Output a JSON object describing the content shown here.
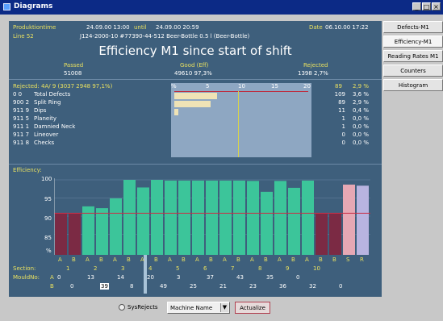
{
  "window": {
    "title": "Diagrams"
  },
  "header": {
    "prod_label": "Produktiontime",
    "from": "24.09.00 13:00",
    "until_label": "until",
    "until": "24.09.00 20:59",
    "date_label": "Date",
    "date": "06.10.00 17:22",
    "line": "Line 52",
    "product": "J124-2000-10 #77390-44-512 Beer-Bottle 0.5 l (Beer-Bottle)"
  },
  "main_title": "Efficiency M1 since start of shift",
  "summary": [
    {
      "label": "Passed",
      "value": "51008"
    },
    {
      "label": "Good (Eff)",
      "value": "49610  97,3%"
    },
    {
      "label": "Rejected",
      "value": "1398  2,7%"
    }
  ],
  "rejects": {
    "header": "Rejected: 4A/ 9   (3037   2948 97,1%)",
    "axis_ticks": [
      "%",
      "5",
      "10",
      "15",
      "20"
    ],
    "header_count": "89",
    "header_pct": "2,9 %",
    "rows": [
      {
        "code": "0  0",
        "name": "Total Defects",
        "count": "109",
        "pct": "3,6 %",
        "bar": 6.5
      },
      {
        "code": "900  2",
        "name": "Split Ring",
        "count": "89",
        "pct": "2,9 %",
        "bar": 5.6
      },
      {
        "code": "911  9",
        "name": "Dips",
        "count": "11",
        "pct": "0,4 %",
        "bar": 0.6
      },
      {
        "code": "911  5",
        "name": "Planeity",
        "count": "1",
        "pct": "0,0 %",
        "bar": 0
      },
      {
        "code": "911  1",
        "name": "Damnied Neck",
        "count": "1",
        "pct": "0,0 %",
        "bar": 0
      },
      {
        "code": "911  7",
        "name": "Lineover",
        "count": "0",
        "pct": "0,0 %",
        "bar": 0
      },
      {
        "code": "911  8",
        "name": "Checks",
        "count": "0",
        "pct": "0,0 %",
        "bar": 0
      }
    ]
  },
  "efficiency": {
    "label": "Efficiency:",
    "yticks": [
      "100",
      "95",
      "90",
      "85",
      "%"
    ],
    "section_label": "Section:",
    "mould_label": "MouldNo:",
    "mould_row_a": "A",
    "mould_row_b": "B",
    "bar_labels": [
      "A",
      "B",
      "A",
      "B",
      "A",
      "B",
      "A",
      "B",
      "A",
      "B",
      "A",
      "B",
      "A",
      "B",
      "A",
      "B",
      "A",
      "B",
      "A",
      "B",
      "B",
      "S",
      "R"
    ],
    "section_numbers": [
      "1",
      "2",
      "3",
      "4",
      "5",
      "6",
      "7",
      "8",
      "9",
      "10"
    ],
    "mould_a": [
      "0",
      "13",
      "14",
      "20",
      "3",
      "37",
      "43",
      "35",
      "0"
    ],
    "mould_b": [
      "0",
      "39",
      "8",
      "49",
      "25",
      "21",
      "23",
      "36",
      "32",
      "0"
    ],
    "mould_b_highlight": "39"
  },
  "chart_data": {
    "type": "bar",
    "title": "Efficiency M1 since start of shift",
    "categories": [
      "1A",
      "1B",
      "2A",
      "2B",
      "3A",
      "3B",
      "4A",
      "4B",
      "5A",
      "5B",
      "6A",
      "6B",
      "7A",
      "7B",
      "8A",
      "8B",
      "9A",
      "9B",
      "10A",
      "10B",
      "B",
      "S",
      "R"
    ],
    "values": [
      90.8,
      90.8,
      92.7,
      92.2,
      94.9,
      100,
      97.9,
      100,
      99.8,
      99.8,
      99.8,
      99.8,
      99.8,
      99.8,
      99.7,
      96.7,
      99.7,
      97.8,
      99.8,
      90.8,
      90.8,
      98.7,
      98.4
    ],
    "colors": [
      "#7b2a44",
      "#7b2a44",
      "#3cc59a",
      "#3cc59a",
      "#3cc59a",
      "#3cc59a",
      "#3cc59a",
      "#3cc59a",
      "#3cc59a",
      "#3cc59a",
      "#3cc59a",
      "#3cc59a",
      "#3cc59a",
      "#3cc59a",
      "#3cc59a",
      "#3cc59a",
      "#3cc59a",
      "#3cc59a",
      "#3cc59a",
      "#7b2a44",
      "#7b2a44",
      "#e6a8b4",
      "#b8b4e0"
    ],
    "ylim": [
      80,
      100
    ],
    "threshold": 90.8
  },
  "sidebar": {
    "tabs": [
      "Defects-M1",
      "Efficiency-M1",
      "Reading Rates M1",
      "Counters",
      "Histogram"
    ],
    "active": 1
  },
  "footer": {
    "radio_label": "SysRejects",
    "select_value": "Machine Name",
    "actualize_label": "Actualize"
  },
  "colors": {
    "panel": "#3e5f7c",
    "yellow_text": "#e8e060",
    "good_bar": "#3cc59a",
    "bad_bar": "#7b2a44"
  }
}
